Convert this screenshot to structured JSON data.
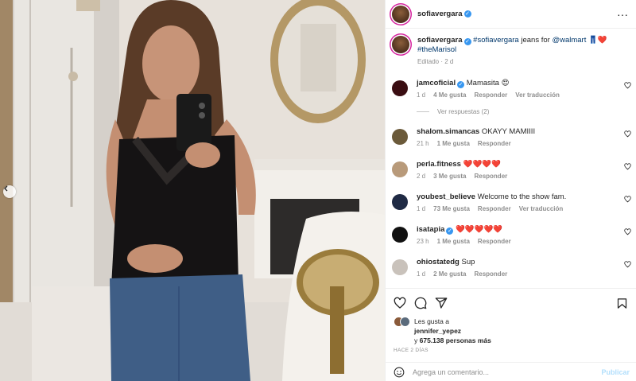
{
  "post": {
    "author": "sofiavergara",
    "caption_hashtag": "#sofiavergara",
    "caption_text": " jeans for ",
    "caption_mention": "@walmart",
    "caption_emoji": " 👖❤️",
    "caption_hashtag2": "#theMarisol",
    "edited_label": "Editado",
    "edited_time": "2 d"
  },
  "comments": [
    {
      "user": "jamcoficial",
      "verified": true,
      "text": "Mamasita 😍",
      "time": "1 d",
      "likes": "4 Me gusta",
      "reply": "Responder",
      "translate": "Ver traducción",
      "replies_label": "Ver respuestas (2)",
      "avatar_color": "#3a0d12"
    },
    {
      "user": "shalom.simancas",
      "verified": false,
      "text": "OKAYY MAMIIII",
      "time": "21 h",
      "likes": "1 Me gusta",
      "reply": "Responder",
      "translate": "",
      "avatar_color": "#6b5a3a"
    },
    {
      "user": "perla.fitness",
      "verified": false,
      "text": "❤️❤️❤️❤️",
      "time": "2 d",
      "likes": "3 Me gusta",
      "reply": "Responder",
      "translate": "",
      "avatar_color": "#b89a7a"
    },
    {
      "user": "youbest_believe",
      "verified": false,
      "text": "Welcome to the show fam.",
      "time": "1 d",
      "likes": "73 Me gusta",
      "reply": "Responder",
      "translate": "Ver traducción",
      "avatar_color": "#1f2a44"
    },
    {
      "user": "isatapia",
      "verified": true,
      "text": "❤️❤️❤️❤️❤️",
      "time": "23 h",
      "likes": "1 Me gusta",
      "reply": "Responder",
      "translate": "",
      "avatar_color": "#111111"
    },
    {
      "user": "ohiostatedg",
      "verified": false,
      "text": "Sup",
      "time": "1 d",
      "likes": "2 Me gusta",
      "reply": "Responder",
      "translate": "",
      "avatar_color": "#c9c2bb"
    }
  ],
  "likes": {
    "prefix": "Les gusta a",
    "user": "jennifer_yepez",
    "suffix_pre": "y ",
    "count": "675.138 personas más",
    "ago": "HACE 2 DÍAS"
  },
  "add_comment": {
    "placeholder": "Agrega un comentario...",
    "publish": "Publicar"
  },
  "icons": {
    "more": "more-options-icon",
    "heart": "heart-icon",
    "comment": "comment-icon",
    "share": "share-icon",
    "save": "bookmark-icon",
    "emoji": "emoji-icon",
    "prev": "chevron-left-icon"
  },
  "colors": {
    "verified": "#3897f0",
    "link": "#00376b",
    "muted": "#8e8e8e",
    "publish_disabled": "#b2dffc"
  }
}
